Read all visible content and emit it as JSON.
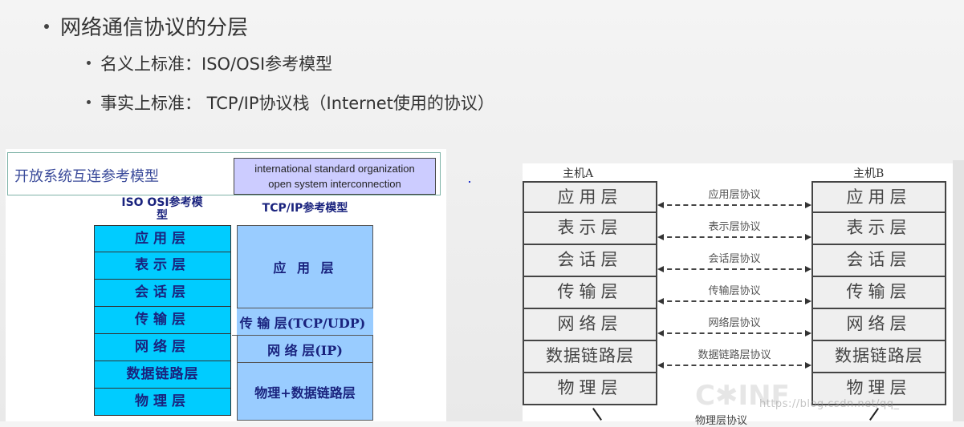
{
  "slide": {
    "bullets": {
      "main": "网络通信协议的分层",
      "sub": [
        "名义上标准：ISO/OSI参考模型",
        "事实上标准： TCP/IP协议栈（Internet使用的协议）"
      ]
    }
  },
  "left_diagram": {
    "title": "开放系统互连参考模型",
    "english_note": [
      "international standard organization",
      "open system interconnection"
    ],
    "osi_heading": [
      "ISO OSI参考模",
      "型"
    ],
    "tcp_heading": "TCP/IP参考模型",
    "osi_layers": [
      "应用层",
      "表示层",
      "会话层",
      "传输层",
      "网络层",
      "数据链路层",
      "物理层"
    ],
    "tcp_layers": [
      {
        "label": "应 用 层",
        "spans": 3
      },
      {
        "label": "传 输 层(TCP/UDP)",
        "spans": 1
      },
      {
        "label": "网 络 层(IP)",
        "spans": 1
      },
      {
        "label": "物理+数据链路层",
        "spans": 2
      }
    ],
    "colors": {
      "osi_fill": "#00ccff",
      "tcp_fill": "#99ccff",
      "text": "#1a237e",
      "note_fill": "#ccccff"
    }
  },
  "right_diagram": {
    "host_a": "主机A",
    "host_b": "主机B",
    "layers": [
      "应用层",
      "表示层",
      "会话层",
      "传输层",
      "网络层",
      "数据链路层",
      "物理层"
    ],
    "protocols": [
      "应用层协议",
      "表示层协议",
      "会话层协议",
      "传输层协议",
      "网络层协议",
      "数据链路层协议"
    ],
    "physical_protocol": "物理层协议",
    "watermark": "https://blog.csdn.net/qq_"
  }
}
